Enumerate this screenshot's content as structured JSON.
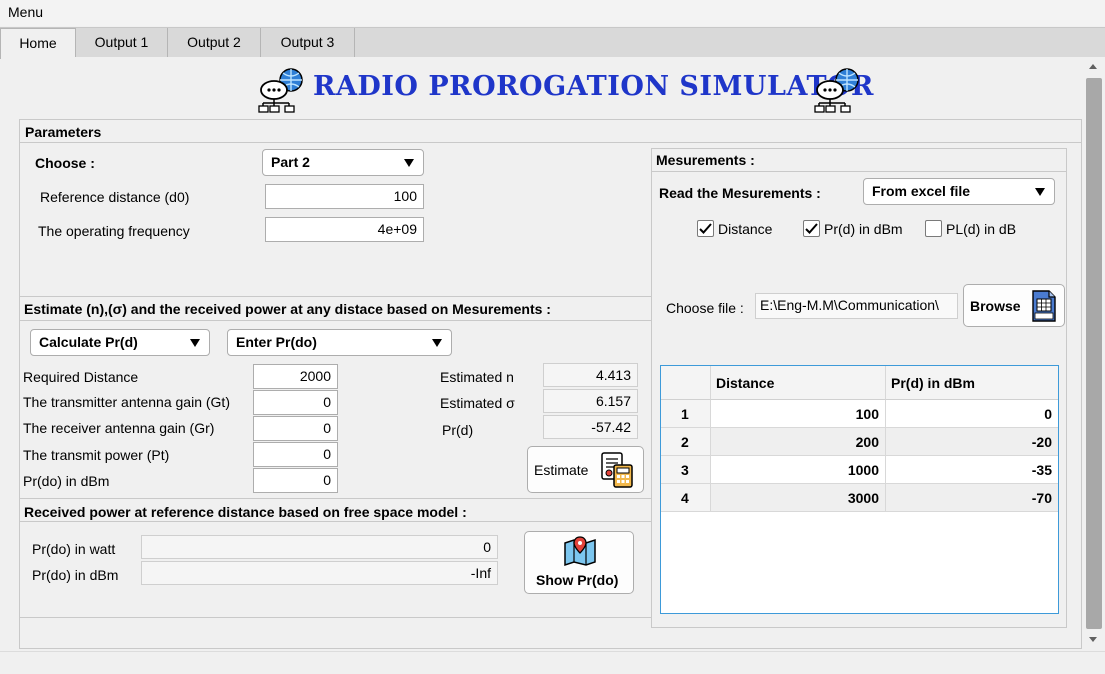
{
  "menu": {
    "label": "Menu"
  },
  "tabs": [
    "Home",
    "Output 1",
    "Output 2",
    "Output 3"
  ],
  "title": "RADIO PROROGATION SIMULATOR",
  "parameters": {
    "title": "Parameters",
    "choose_label": "Choose :",
    "choose_value": "Part 2",
    "ref_distance_label": "Reference distance (d0)",
    "ref_distance_value": "100",
    "frequency_label": "The operating frequency",
    "frequency_value": "4e+09"
  },
  "estimate": {
    "title": "Estimate (n),(σ) and the received power at any distace based on Mesurements :",
    "mode_dropdown": "Calculate Pr(d)",
    "input_dropdown": "Enter Pr(do)",
    "required_distance_label": "Required Distance",
    "required_distance_value": "2000",
    "gt_label": "The transmitter antenna gain (Gt)",
    "gt_value": "0",
    "gr_label": "The receiver antenna gain (Gr)",
    "gr_value": "0",
    "pt_label": "The transmit power (Pt)",
    "pt_value": "0",
    "prdo_label": "Pr(do) in dBm",
    "prdo_value": "0",
    "est_n_label": "Estimated n",
    "est_n_value": "4.413",
    "est_sigma_label": "Estimated σ",
    "est_sigma_value": "6.157",
    "prd_label": "Pr(d)",
    "prd_value": "-57.42",
    "estimate_button": "Estimate"
  },
  "free_space": {
    "title": "Received power at reference distance based on free space model :",
    "watt_label": "Pr(do) in watt",
    "watt_value": "0",
    "dbm_label": "Pr(do) in dBm",
    "dbm_value": "-Inf",
    "show_button": "Show Pr(do)"
  },
  "measurements": {
    "title": "Mesurements :",
    "read_label": "Read the Mesurements :",
    "read_value": "From excel file",
    "checkboxes": [
      {
        "label": "Distance",
        "checked": true
      },
      {
        "label": "Pr(d) in dBm",
        "checked": true
      },
      {
        "label": "PL(d) in dB",
        "checked": false
      }
    ],
    "choose_file_label": "Choose file :",
    "file_path": "E:\\Eng-M.M\\Communication\\",
    "browse_button": "Browse",
    "table": {
      "columns": [
        "Distance",
        "Pr(d) in dBm"
      ],
      "rows": [
        {
          "index": "1",
          "distance": "100",
          "prd": "0"
        },
        {
          "index": "2",
          "distance": "200",
          "prd": "-20"
        },
        {
          "index": "3",
          "distance": "1000",
          "prd": "-35"
        },
        {
          "index": "4",
          "distance": "3000",
          "prd": "-70"
        }
      ]
    }
  },
  "icons": [
    "network-icon",
    "calculator-icon",
    "map-pin-icon",
    "excel-file-icon",
    "check-icon",
    "dropdown-arrow-icon"
  ],
  "colors": {
    "title": "#1f36c9",
    "table_border": "#3d9ad9",
    "background": "#f0f0f0"
  }
}
